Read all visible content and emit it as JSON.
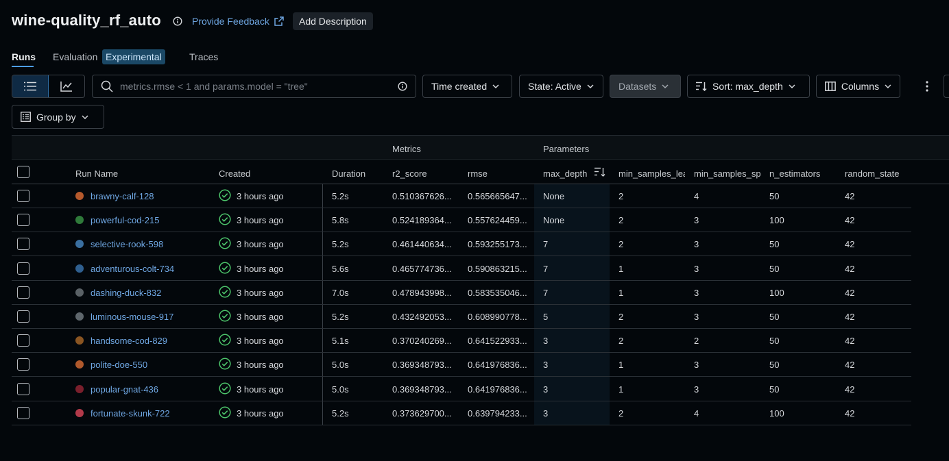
{
  "header": {
    "title": "wine-quality_rf_auto",
    "feedback_label": "Provide Feedback",
    "add_description_label": "Add Description"
  },
  "tabs": [
    {
      "label": "Runs",
      "active": true
    },
    {
      "label": "Evaluation",
      "badge": "Experimental"
    },
    {
      "label": "Traces"
    }
  ],
  "toolbar": {
    "search_placeholder": "metrics.rmse < 1 and params.model = \"tree\"",
    "time_created_label": "Time created",
    "state_label": "State: Active",
    "datasets_label": "Datasets",
    "sort_label": "Sort: max_depth",
    "columns_label": "Columns",
    "group_by_label": "Group by"
  },
  "table": {
    "groups": {
      "metrics": "Metrics",
      "parameters": "Parameters"
    },
    "columns": {
      "run_name": "Run Name",
      "created": "Created",
      "duration": "Duration",
      "r2_score": "r2_score",
      "rmse": "rmse",
      "max_depth": "max_depth",
      "min_samples_leaf": "min_samples_lea",
      "min_samples_split": "min_samples_sp",
      "n_estimators": "n_estimators",
      "random_state": "random_state"
    },
    "rows": [
      {
        "name": "brawny-calf-128",
        "color": "#b5592c",
        "created": "3 hours ago",
        "duration": "5.2s",
        "r2": "0.510367626...",
        "rmse": "0.565665647...",
        "max_depth": "None",
        "leaf": "2",
        "split": "4",
        "n_est": "50",
        "rs": "42"
      },
      {
        "name": "powerful-cod-215",
        "color": "#2f7a3a",
        "created": "3 hours ago",
        "duration": "5.8s",
        "r2": "0.524189364...",
        "rmse": "0.557624459...",
        "max_depth": "None",
        "leaf": "2",
        "split": "3",
        "n_est": "100",
        "rs": "42"
      },
      {
        "name": "selective-rook-598",
        "color": "#3a6fa0",
        "created": "3 hours ago",
        "duration": "5.2s",
        "r2": "0.461440634...",
        "rmse": "0.593255173...",
        "max_depth": "7",
        "leaf": "2",
        "split": "3",
        "n_est": "50",
        "rs": "42"
      },
      {
        "name": "adventurous-colt-734",
        "color": "#2f5f8f",
        "created": "3 hours ago",
        "duration": "5.6s",
        "r2": "0.465774736...",
        "rmse": "0.590863215...",
        "max_depth": "7",
        "leaf": "1",
        "split": "3",
        "n_est": "50",
        "rs": "42"
      },
      {
        "name": "dashing-duck-832",
        "color": "#5a6166",
        "created": "3 hours ago",
        "duration": "7.0s",
        "r2": "0.478943998...",
        "rmse": "0.583535046...",
        "max_depth": "7",
        "leaf": "1",
        "split": "3",
        "n_est": "100",
        "rs": "42"
      },
      {
        "name": "luminous-mouse-917",
        "color": "#5e666c",
        "created": "3 hours ago",
        "duration": "5.2s",
        "r2": "0.432492053...",
        "rmse": "0.608990778...",
        "max_depth": "5",
        "leaf": "2",
        "split": "3",
        "n_est": "50",
        "rs": "42"
      },
      {
        "name": "handsome-cod-829",
        "color": "#8a5522",
        "created": "3 hours ago",
        "duration": "5.1s",
        "r2": "0.370240269...",
        "rmse": "0.641522933...",
        "max_depth": "3",
        "leaf": "2",
        "split": "2",
        "n_est": "50",
        "rs": "42"
      },
      {
        "name": "polite-doe-550",
        "color": "#b0592c",
        "created": "3 hours ago",
        "duration": "5.0s",
        "r2": "0.369348793...",
        "rmse": "0.641976836...",
        "max_depth": "3",
        "leaf": "1",
        "split": "3",
        "n_est": "50",
        "rs": "42"
      },
      {
        "name": "popular-gnat-436",
        "color": "#7a1f2c",
        "created": "3 hours ago",
        "duration": "5.0s",
        "r2": "0.369348793...",
        "rmse": "0.641976836...",
        "max_depth": "3",
        "leaf": "1",
        "split": "3",
        "n_est": "50",
        "rs": "42"
      },
      {
        "name": "fortunate-skunk-722",
        "color": "#b23a4a",
        "created": "3 hours ago",
        "duration": "5.2s",
        "r2": "0.373629700...",
        "rmse": "0.639794233...",
        "max_depth": "3",
        "leaf": "2",
        "split": "4",
        "n_est": "100",
        "rs": "42"
      }
    ]
  },
  "colors": {
    "accent": "#4d9eea",
    "link": "#6fa7e3",
    "success": "#4cc46a",
    "background": "#03070b"
  }
}
